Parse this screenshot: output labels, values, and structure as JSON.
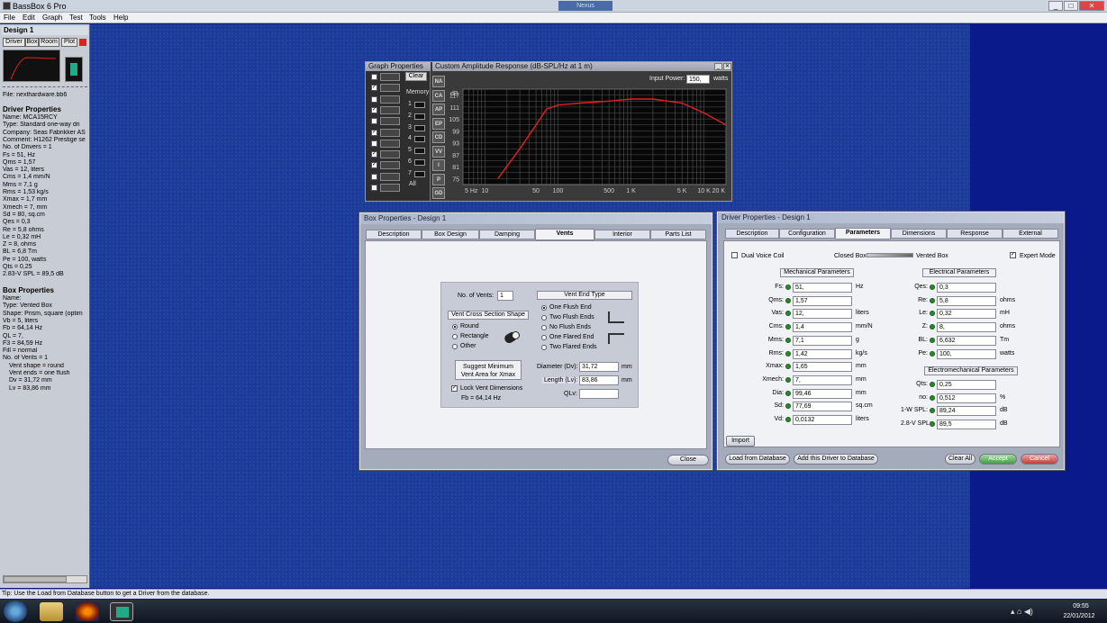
{
  "app": {
    "title": "BassBox 6 Pro"
  },
  "menu": [
    "File",
    "Edit",
    "Graph",
    "Test",
    "Tools",
    "Help"
  ],
  "sidebar": {
    "design_title": "Design 1",
    "buttons": [
      "Driver",
      "Box",
      "Room",
      "Plot"
    ],
    "file": "File: nexthardware.bb6",
    "driver_heading": "Driver Properties",
    "driver_lines": [
      "Name: MCA15RCY",
      "Type: Standard one-way dri",
      "Company: Seas Fabrikker AS",
      "Comment: H1262 Prestige se",
      "No. of Drivers = 1",
      "Fs = 51, Hz",
      "Qms = 1,57",
      "Vas = 12, liters",
      "Cms = 1,4 mm/N",
      "Mms = 7,1 g",
      "Rms = 1,53 kg/s",
      "Xmax = 1,7 mm",
      "Xmech = 7, mm",
      "Sd = 80, sq.cm",
      "Qes = 0,3",
      "Re = 5,8 ohms",
      "Le = 0,32 mH",
      "Z = 8, ohms",
      "BL = 6,8 Tm",
      "Pe = 100, watts",
      "Qts = 0,25",
      "2.83-V SPL = 89,5 dB"
    ],
    "box_heading": "Box Properties",
    "box_lines": [
      "Name:",
      "Type: Vented Box",
      "Shape: Prism, square (optim",
      "Vb = 5, liters",
      "Fb = 64,14 Hz",
      "QL = 7,",
      "F3 = 84,59 Hz",
      "Fill = normal",
      "No. of Vents = 1",
      "Vent shape = round",
      "Vent ends = one flush",
      "Dv = 31,72 mm",
      "Lv = 83,86 mm"
    ]
  },
  "graph_props": {
    "title": "Graph Properties",
    "clear": "Clear",
    "memory": "Memory",
    "slots": [
      "1",
      "2",
      "3",
      "4",
      "5",
      "6",
      "7"
    ],
    "all": "All",
    "side_buttons": [
      "NA",
      "CA",
      "AP",
      "EP",
      "CD",
      "VV",
      "I",
      "P",
      "GD"
    ]
  },
  "graph": {
    "title": "Custom Amplitude Response (dB-SPL/Hz at 1 m)",
    "input_power_label": "Input Power:",
    "input_power": "150,",
    "watts": "watts"
  },
  "chart_data": {
    "type": "line",
    "title": "Custom Amplitude Response (dB-SPL/Hz at 1 m)",
    "ylabel": "dB",
    "y_ticks": [
      "117",
      "111",
      "105",
      "99",
      "93",
      "87",
      "81",
      "75"
    ],
    "x_ticks": [
      "5 Hz",
      "10",
      "50",
      "100",
      "500",
      "1 K",
      "5 K",
      "10 K",
      "20 K"
    ],
    "ylim": [
      72,
      120
    ],
    "xlim": [
      5,
      20000
    ],
    "log_x": true,
    "grid": true,
    "color": "#e02020",
    "x": [
      15,
      30,
      50,
      70,
      100,
      200,
      500,
      1000,
      2000,
      5000,
      10000,
      20000
    ],
    "y": [
      75,
      90,
      102,
      110,
      112,
      113,
      114,
      115,
      115,
      113,
      108,
      102
    ]
  },
  "box_dialog": {
    "title": "Box Properties - Design 1",
    "tabs": [
      "Description",
      "Box Design",
      "Damping",
      "Vents",
      "Interior",
      "Parts List"
    ],
    "num_vents_label": "No. of Vents:",
    "num_vents": "1",
    "shape_title": "Vent Cross Section Shape",
    "shapes": [
      "Round",
      "Rectangle",
      "Other"
    ],
    "end_title": "Vent End Type",
    "ends": [
      "One Flush End",
      "Two Flush Ends",
      "No Flush Ends",
      "One Flared End",
      "Two Flared Ends"
    ],
    "suggest": "Suggest Minimum\nVent Area for Xmax",
    "diameter_label": "Diameter (Dv):",
    "diameter": "31,72",
    "length_label": "Length (Lv):",
    "length": "83,86",
    "qlv_label": "QLv:",
    "unit_mm": "mm",
    "lock": "Lock Vent Dimensions",
    "fb": "Fb = 64,14 Hz",
    "close": "Close"
  },
  "driver_dialog": {
    "title": "Driver Properties - Design 1",
    "tabs": [
      "Description",
      "Configuration",
      "Parameters",
      "Dimensions",
      "Response",
      "External"
    ],
    "dual_vc": "Dual Voice Coil",
    "closed": "Closed Box",
    "vented": "Vented Box",
    "expert": "Expert Mode",
    "mech_title": "Mechanical Parameters",
    "elec_title": "Electrical Parameters",
    "em_title": "Electromechanical Parameters",
    "mech": [
      {
        "l": "Fs:",
        "v": "51,",
        "u": "Hz"
      },
      {
        "l": "Qms:",
        "v": "1,57",
        "u": ""
      },
      {
        "l": "Vas:",
        "v": "12,",
        "u": "liters"
      },
      {
        "l": "Cms:",
        "v": "1,4",
        "u": "mm/N"
      },
      {
        "l": "Mms:",
        "v": "7,1",
        "u": "g"
      },
      {
        "l": "Rms:",
        "v": "1,42",
        "u": "kg/s"
      },
      {
        "l": "Xmax:",
        "v": "1,65",
        "u": "mm"
      },
      {
        "l": "Xmech:",
        "v": "7,",
        "u": "mm"
      },
      {
        "l": "Dia:",
        "v": "99,46",
        "u": "mm"
      },
      {
        "l": "Sd:",
        "v": "77,69",
        "u": "sq.cm"
      },
      {
        "l": "Vd:",
        "v": "0,0132",
        "u": "liters"
      }
    ],
    "elec": [
      {
        "l": "Qes:",
        "v": "0,3",
        "u": ""
      },
      {
        "l": "Re:",
        "v": "5,8",
        "u": "ohms"
      },
      {
        "l": "Le:",
        "v": "0,32",
        "u": "mH"
      },
      {
        "l": "Z:",
        "v": "8,",
        "u": "ohms"
      },
      {
        "l": "BL:",
        "v": "6,632",
        "u": "Tm"
      },
      {
        "l": "Pe:",
        "v": "100,",
        "u": "watts"
      }
    ],
    "em": [
      {
        "l": "Qts:",
        "v": "0,25",
        "u": ""
      },
      {
        "l": "no:",
        "v": "0,512",
        "u": "%"
      },
      {
        "l": "1-W SPL:",
        "v": "89,24",
        "u": "dB"
      },
      {
        "l": "2.8-V SPL:",
        "v": "89,5",
        "u": "dB"
      }
    ],
    "import": "Import",
    "load": "Load from Database",
    "add": "Add this Driver to Database",
    "clear": "Clear All",
    "accept": "Accept",
    "cancel": "Cancel"
  },
  "status": "Tip: Use the Load from Database button to get a Driver from the database.",
  "taskbar": {
    "time": "09:55",
    "date": "22/01/2012",
    "tab": "Nexus"
  }
}
